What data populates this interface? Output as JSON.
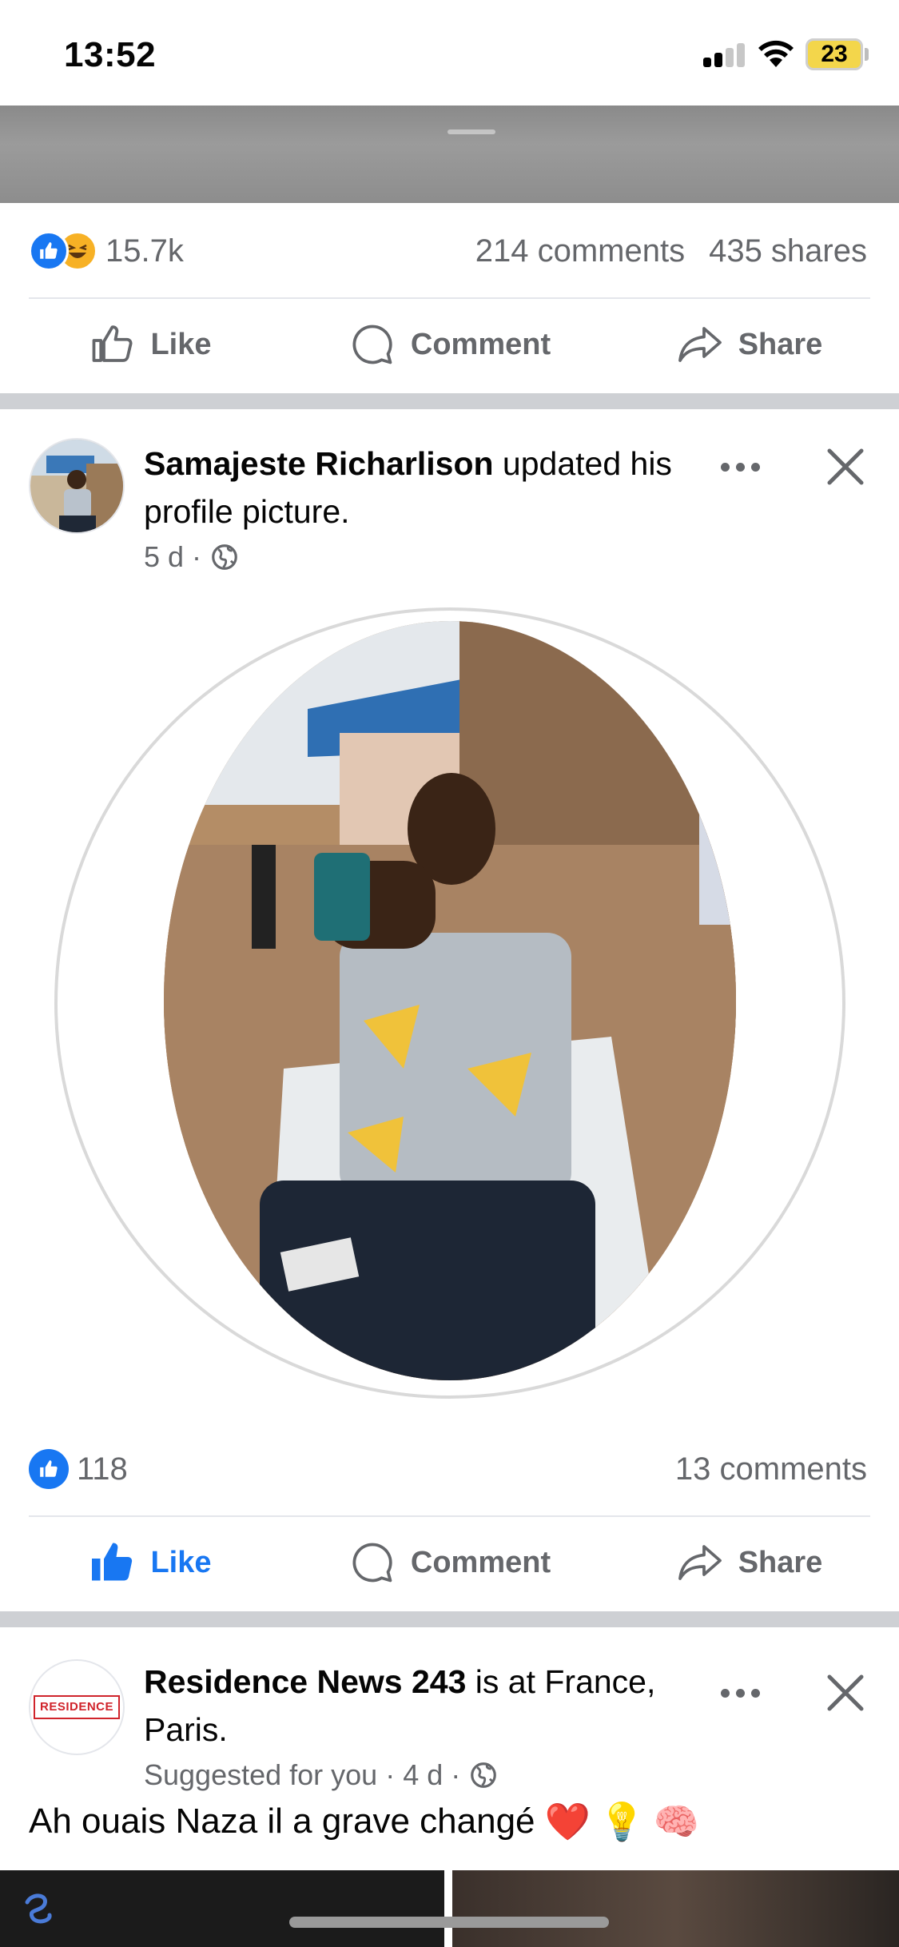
{
  "status_bar": {
    "time": "13:52",
    "battery": "23",
    "icons": [
      "cellular-signal-icon",
      "wifi-icon",
      "battery-icon"
    ]
  },
  "previous_post": {
    "reaction_count": "15.7k",
    "comments": "214 comments",
    "shares": "435 shares",
    "reaction_icons": [
      "like-reaction-icon",
      "haha-reaction-icon"
    ]
  },
  "actions": {
    "like": "Like",
    "comment": "Comment",
    "share": "Share"
  },
  "post1": {
    "author": "Samajeste Richarlison",
    "action_text": " updated his profile picture.",
    "time": "5 d",
    "audience_icon": "globe-icon",
    "reaction_count": "118",
    "comments": "13 comments",
    "liked": true
  },
  "post2": {
    "author": "Residence News 243",
    "action_text": " is at France, Paris.",
    "meta": "Suggested for you · 4 d",
    "audience_icon": "globe-icon",
    "avatar_text": "RESIDENCE",
    "text": "Ah ouais Naza il a grave changé",
    "emojis": [
      "❤️",
      "💡",
      "🧠"
    ]
  },
  "colors": {
    "accent": "#1877f2",
    "secondary_text": "#65676b",
    "separator": "#ced0d4",
    "battery": "#f3d64b"
  }
}
